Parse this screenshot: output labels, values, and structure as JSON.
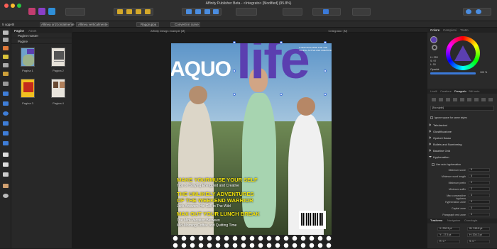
{
  "window": {
    "title": "Affinity Publisher Beta - <Integrato> [Modified] (95.8%)"
  },
  "context": {
    "objects": "5 oggetti",
    "align_h": "Allinea orizzontalmente",
    "align_v": "Allinea verticalmente",
    "group": "Raggruppa",
    "convert": "Converti in curve"
  },
  "pages_panel": {
    "tabs": [
      "Pagine",
      "Asset"
    ],
    "master_label": "Pagine master",
    "pages_label": "Pagine",
    "pages": [
      {
        "label": "Pagina 1"
      },
      {
        "label": "Pagina 2"
      },
      {
        "label": "Pagina 3"
      },
      {
        "label": "Pagina 4"
      }
    ]
  },
  "doc_tabs": [
    "Affinity Design example [M]",
    "<Integrato> [M]"
  ],
  "cover": {
    "brand_left": "AQUO",
    "brand_right": "life",
    "blurb": "A NEW MAGAZINE FOR THE YOUNG, ACTIVE AND CREATIVE",
    "headlines": [
      {
        "title": "MAKE YOURMUSE YOUR SELF",
        "sub": "Tips on Staying Energized and Creative"
      },
      {
        "title": "THE UNLIKELY ADVENTURES OF THE WEEKEND WARRIOR",
        "sub": "Jack Answers His Call to The Wild"
      },
      {
        "title": "MAX OUT YOUR LUNCH BREAK",
        "sub": "The Mini-Vacation Between Mid-Morning Coffee and Quitting Time"
      }
    ],
    "title_lines": {
      "h2a": "THE UNLIKELY ADVENTURES",
      "h2b": "OF THE WEEKEND WARRIOR",
      "s3a": "The Mini-Vacation Between",
      "s3b": "Mid-Morning Coffee and Quitting Time"
    }
  },
  "right_panel": {
    "color_tabs": [
      "Colore",
      "Campioni",
      "Tratto"
    ],
    "values": {
      "h": "H: 253",
      "s": "S: 97",
      "l": "L: 51"
    },
    "opacity_label": "Opacità",
    "opacity": "100 %",
    "para_tabs": [
      "Livelli",
      "Carattere",
      "Paragrafo",
      "Stili testo"
    ],
    "style": "[No style]",
    "ignore_spacing": "Ignore space for same styles",
    "sections": [
      "Tabulazioni",
      "Giustificazione",
      "Opzioni flusso",
      "Bullets and Numbering",
      "Baseline Grid",
      "Hyphenation"
    ],
    "auto_hyphen": "Use auto-hyphenation",
    "hyphen_fields": [
      {
        "label": "Minimum score",
        "value": "5"
      },
      {
        "label": "Minimum word length",
        "value": "5"
      },
      {
        "label": "Minimum prefix",
        "value": "2"
      },
      {
        "label": "Minimum suffix",
        "value": "2"
      },
      {
        "label": "Max consecutive hyphens",
        "value": "3"
      },
      {
        "label": "Hyphenation zone",
        "value": "0"
      },
      {
        "label": "Capital zone",
        "value": "0"
      },
      {
        "label": "Paragraph end zone",
        "value": "0"
      }
    ],
    "transform_tabs": [
      "Trasforma",
      "Navigatore",
      "Cronologia"
    ],
    "transform": {
      "x": "X: 230.3 pt",
      "w": "W: 315.8 pt",
      "y": "Y: -17.5 pt",
      "h": "H: 204.2 pt",
      "r": "R: 0 °",
      "s": "S: 0 °"
    }
  },
  "colors": {
    "accent": "#3b7ad9",
    "magazine_purple": "#5b3fb0",
    "headline_yellow": "#f2e10a"
  }
}
